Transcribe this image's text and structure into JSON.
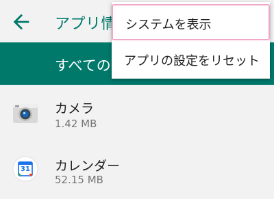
{
  "header": {
    "title": "アプリ情",
    "back_icon": "arrow-back-icon"
  },
  "filter": {
    "label": "すべての"
  },
  "apps": [
    {
      "name": "カメラ",
      "size": "1.42 MB",
      "icon": "camera-icon"
    },
    {
      "name": "カレンダー",
      "size": "52.15 MB",
      "icon": "calendar-icon",
      "icon_text": "31"
    }
  ],
  "menu": {
    "items": [
      {
        "label": "システムを表示"
      },
      {
        "label": "アプリの設定をリセット"
      }
    ]
  },
  "colors": {
    "accent": "#00796b",
    "menu_highlight": "#f0a8c8"
  }
}
